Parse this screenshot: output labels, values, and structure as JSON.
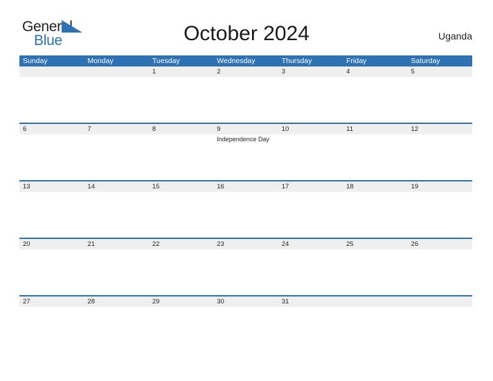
{
  "brand": {
    "name_part1": "General",
    "name_part2": "Blue",
    "mark_icon": "triangle-flag-icon",
    "color_primary": "#2a72b5",
    "color_text": "#231f20"
  },
  "header": {
    "title": "October 2024",
    "country": "Uganda"
  },
  "calendar": {
    "header_bg": "#2e72b4",
    "strip_bg": "#efefef",
    "weekdays": [
      "Sunday",
      "Monday",
      "Tuesday",
      "Wednesday",
      "Thursday",
      "Friday",
      "Saturday"
    ],
    "weeks": [
      {
        "days": [
          {
            "date": "",
            "events": []
          },
          {
            "date": "",
            "events": []
          },
          {
            "date": "1",
            "events": []
          },
          {
            "date": "2",
            "events": []
          },
          {
            "date": "3",
            "events": []
          },
          {
            "date": "4",
            "events": []
          },
          {
            "date": "5",
            "events": []
          }
        ]
      },
      {
        "days": [
          {
            "date": "6",
            "events": []
          },
          {
            "date": "7",
            "events": []
          },
          {
            "date": "8",
            "events": []
          },
          {
            "date": "9",
            "events": [
              "Independence Day"
            ]
          },
          {
            "date": "10",
            "events": []
          },
          {
            "date": "11",
            "events": []
          },
          {
            "date": "12",
            "events": []
          }
        ]
      },
      {
        "days": [
          {
            "date": "13",
            "events": []
          },
          {
            "date": "14",
            "events": []
          },
          {
            "date": "15",
            "events": []
          },
          {
            "date": "16",
            "events": []
          },
          {
            "date": "17",
            "events": []
          },
          {
            "date": "18",
            "events": []
          },
          {
            "date": "19",
            "events": []
          }
        ]
      },
      {
        "days": [
          {
            "date": "20",
            "events": []
          },
          {
            "date": "21",
            "events": []
          },
          {
            "date": "22",
            "events": []
          },
          {
            "date": "23",
            "events": []
          },
          {
            "date": "24",
            "events": []
          },
          {
            "date": "25",
            "events": []
          },
          {
            "date": "26",
            "events": []
          }
        ]
      },
      {
        "days": [
          {
            "date": "27",
            "events": []
          },
          {
            "date": "28",
            "events": []
          },
          {
            "date": "29",
            "events": []
          },
          {
            "date": "30",
            "events": []
          },
          {
            "date": "31",
            "events": []
          },
          {
            "date": "",
            "events": []
          },
          {
            "date": "",
            "events": []
          }
        ]
      }
    ]
  }
}
